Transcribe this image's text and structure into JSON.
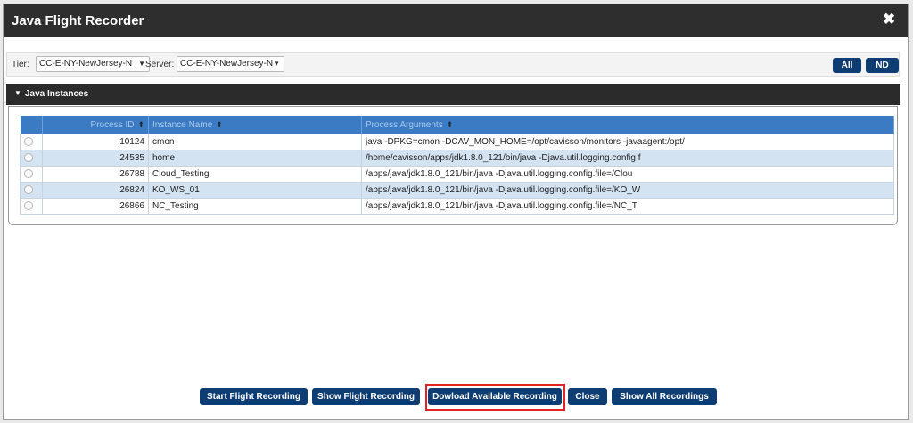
{
  "window": {
    "title": "Java Flight Recorder"
  },
  "toolbar": {
    "tier_label": "Tier:",
    "tier_value": "CC-E-NY-NewJersey-N",
    "server_label": "Server:",
    "server_value": "CC-E-NY-NewJersey-N",
    "all_label": "All",
    "nd_label": "ND"
  },
  "section": {
    "title": "Java Instances"
  },
  "table": {
    "headers": {
      "process_id": "Process ID",
      "instance_name": "Instance Name",
      "process_arguments": "Process Arguments"
    },
    "rows": [
      {
        "process_id": "10124",
        "instance_name": "cmon",
        "process_arguments": "java -DPKG=cmon -DCAV_MON_HOME=/opt/cavisson/monitors -javaagent:/opt/"
      },
      {
        "process_id": "24535",
        "instance_name": "home",
        "process_arguments": "/home/cavisson/apps/jdk1.8.0_121/bin/java -Djava.util.logging.config.f"
      },
      {
        "process_id": "26788",
        "instance_name": "Cloud_Testing",
        "process_arguments": "/apps/java/jdk1.8.0_121/bin/java -Djava.util.logging.config.file=/Clou"
      },
      {
        "process_id": "26824",
        "instance_name": "KO_WS_01",
        "process_arguments": "/apps/java/jdk1.8.0_121/bin/java -Djava.util.logging.config.file=/KO_W"
      },
      {
        "process_id": "26866",
        "instance_name": "NC_Testing",
        "process_arguments": "/apps/java/jdk1.8.0_121/bin/java -Djava.util.logging.config.file=/NC_T"
      }
    ]
  },
  "footer": {
    "start_label": "Start Flight Recording",
    "show_label": "Show Flight Recording",
    "download_label": "Dowload Available Recording",
    "close_label": "Close",
    "show_all_label": "Show All Recordings"
  },
  "colors": {
    "title_bar": "#2e2e2e",
    "button": "#0d3d73",
    "table_header": "#3a7bc4",
    "row_alt": "#d4e3f2",
    "highlight": "#e32323"
  },
  "icons": {
    "close": "close-icon",
    "collapse": "caret-down-icon",
    "sort": "sort-icon",
    "dropdown": "chevron-down-icon"
  }
}
